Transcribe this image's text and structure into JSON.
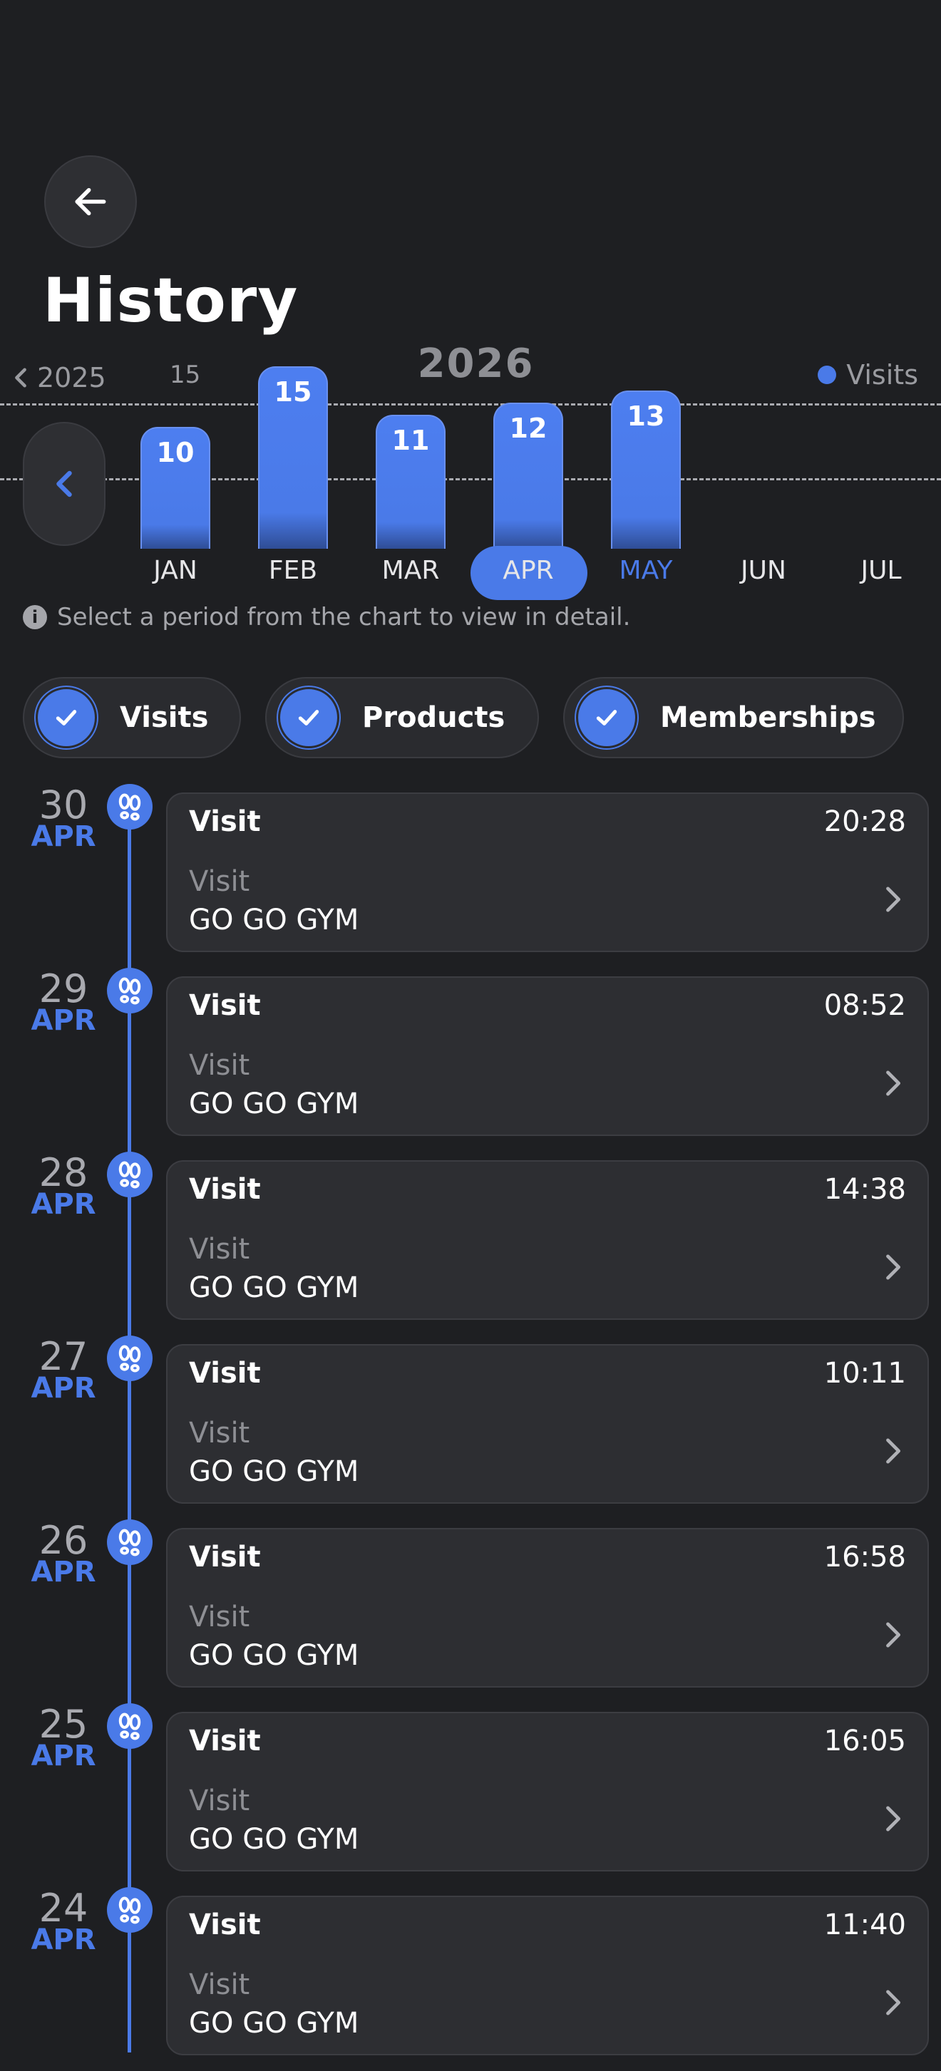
{
  "header": {
    "title": "History",
    "back_icon": "arrow-left-icon"
  },
  "chart": {
    "prev_year_label": "2025",
    "top_label": "15",
    "year": "2026",
    "legend_label": "Visits",
    "selected_month": "APR"
  },
  "colors": {
    "accent": "#4a7ae8",
    "background": "#1e1f22",
    "card": "#2d2e32"
  },
  "chart_data": {
    "type": "bar",
    "title": "2026",
    "categories": [
      "JAN",
      "FEB",
      "MAR",
      "APR",
      "MAY",
      "JUN",
      "JUL"
    ],
    "series": [
      {
        "name": "Visits",
        "values": [
          10,
          15,
          11,
          12,
          13,
          null,
          null
        ]
      }
    ],
    "value_labels": [
      "10",
      "15",
      "11",
      "12",
      "13"
    ],
    "reference_lines": [
      15,
      7.5
    ],
    "legend_position": "top-right",
    "grid": false
  },
  "hint": "Select a period from the chart to view in detail.",
  "filters": [
    {
      "label": "Visits",
      "checked": true
    },
    {
      "label": "Products",
      "checked": true
    },
    {
      "label": "Memberships",
      "checked": true
    }
  ],
  "entries": [
    {
      "day": "30",
      "month": "APR",
      "title": "Visit",
      "time": "20:28",
      "subtitle": "Visit",
      "place": "GO GO GYM"
    },
    {
      "day": "29",
      "month": "APR",
      "title": "Visit",
      "time": "08:52",
      "subtitle": "Visit",
      "place": "GO GO GYM"
    },
    {
      "day": "28",
      "month": "APR",
      "title": "Visit",
      "time": "14:38",
      "subtitle": "Visit",
      "place": "GO GO GYM"
    },
    {
      "day": "27",
      "month": "APR",
      "title": "Visit",
      "time": "10:11",
      "subtitle": "Visit",
      "place": "GO GO GYM"
    },
    {
      "day": "26",
      "month": "APR",
      "title": "Visit",
      "time": "16:58",
      "subtitle": "Visit",
      "place": "GO GO GYM"
    },
    {
      "day": "25",
      "month": "APR",
      "title": "Visit",
      "time": "16:05",
      "subtitle": "Visit",
      "place": "GO GO GYM"
    },
    {
      "day": "24",
      "month": "APR",
      "title": "Visit",
      "time": "11:40",
      "subtitle": "Visit",
      "place": "GO GO GYM"
    }
  ]
}
